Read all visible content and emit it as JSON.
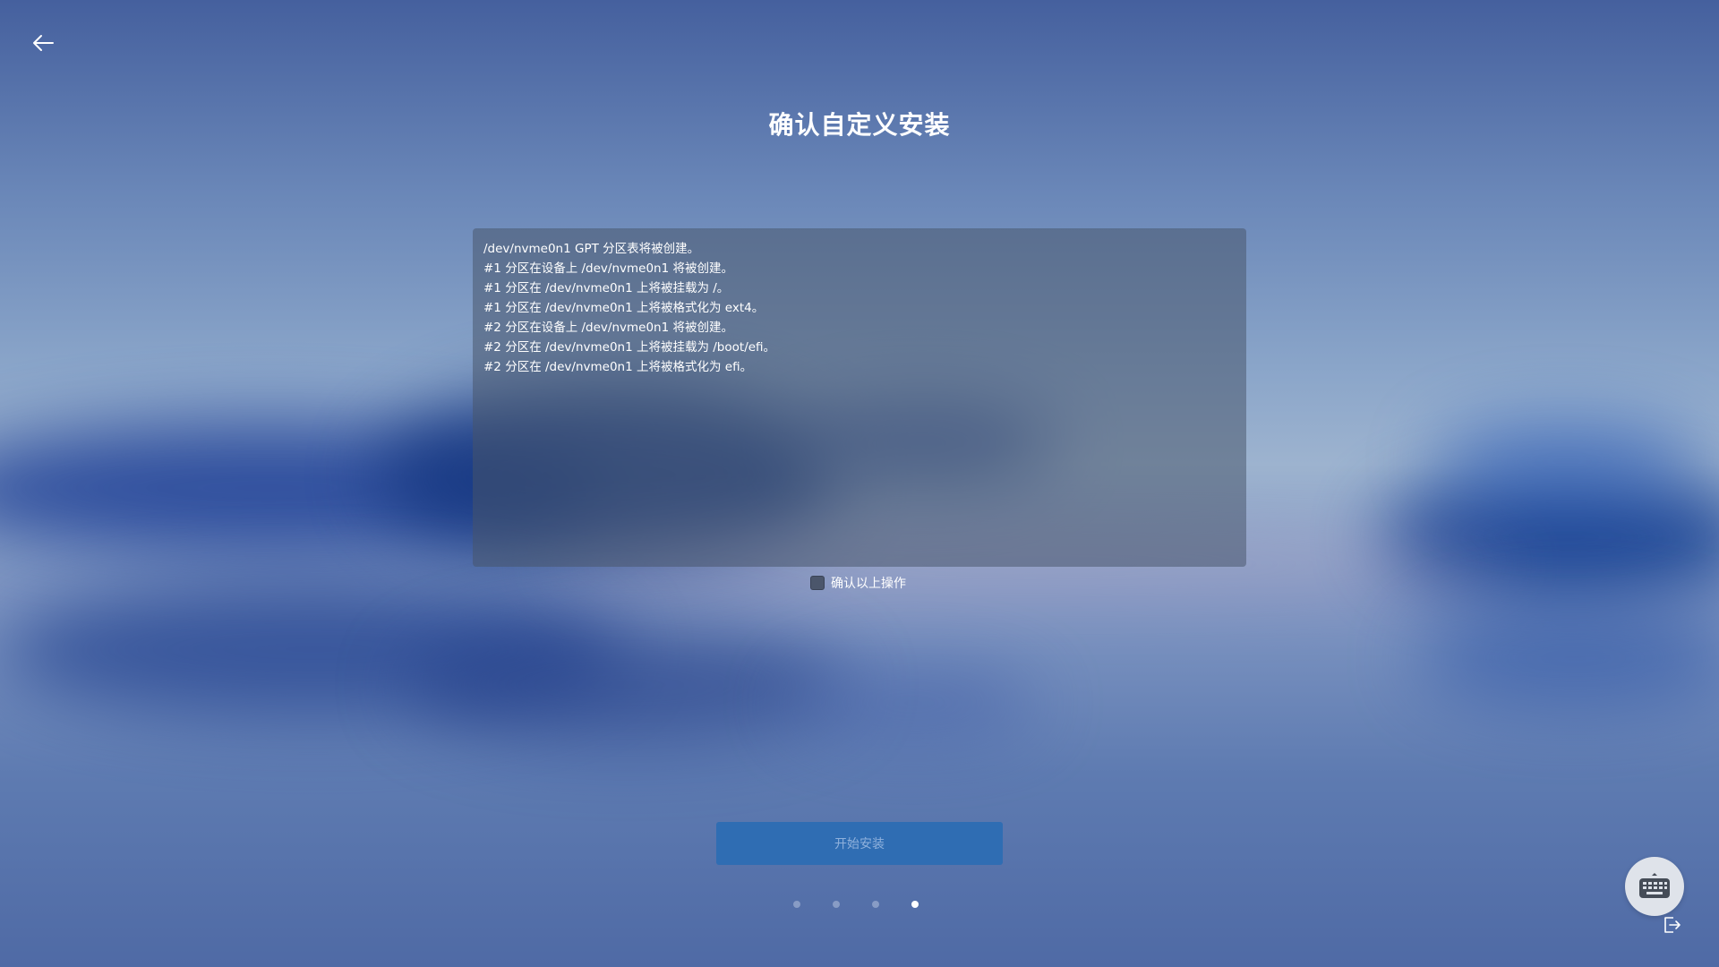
{
  "header": {
    "title": "确认自定义安装"
  },
  "log": {
    "lines": [
      "/dev/nvme0n1 GPT 分区表将被创建。",
      "#1 分区在设备上 /dev/nvme0n1 将被创建。",
      "#1 分区在 /dev/nvme0n1 上将被挂载为 /。",
      "#1 分区在 /dev/nvme0n1 上将被格式化为 ext4。",
      "#2 分区在设备上 /dev/nvme0n1 将被创建。",
      "#2 分区在 /dev/nvme0n1 上将被挂载为 /boot/efi。",
      "#2 分区在 /dev/nvme0n1 上将被格式化为 efi。"
    ]
  },
  "confirm": {
    "label": "确认以上操作",
    "checked": false
  },
  "install_button": {
    "label": "开始安装",
    "enabled": false
  },
  "pager": {
    "total": 4,
    "current": 4
  },
  "icons": {
    "back": "back-arrow-icon",
    "keyboard": "keyboard-icon",
    "exit": "exit-icon"
  },
  "colors": {
    "button": "#2f6db3",
    "button_text": "#8fb1dc",
    "panel": "rgba(70,85,105,0.52)"
  }
}
